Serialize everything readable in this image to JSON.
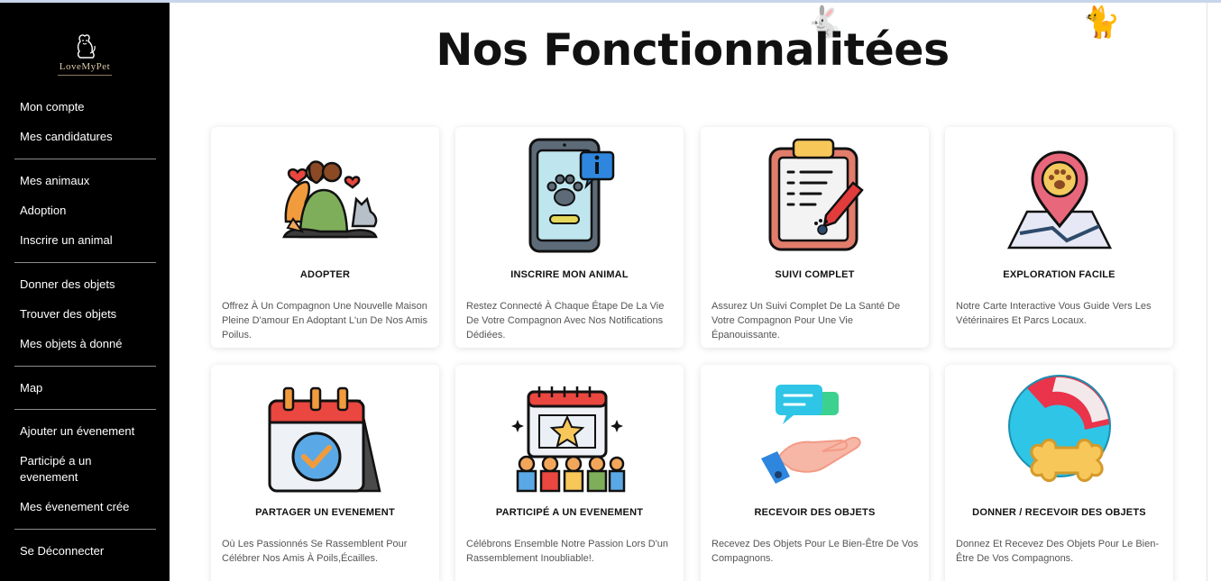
{
  "sidebar": {
    "logo_text": "LoveMyPet",
    "items": [
      {
        "label": "Mon compte"
      },
      {
        "label": "Mes candidatures"
      },
      {
        "label": "Mes animaux"
      },
      {
        "label": "Adoption"
      },
      {
        "label": "Inscrire un animal"
      },
      {
        "label": "Donner des objets"
      },
      {
        "label": "Trouver des objets"
      },
      {
        "label": "Mes objets à donné"
      },
      {
        "label": "Map"
      },
      {
        "label": "Ajouter un évenement"
      },
      {
        "label": "Participé a un evenement"
      },
      {
        "label": "Mes évenement crée"
      },
      {
        "label": "Se Déconnecter"
      }
    ]
  },
  "main": {
    "title": "Nos Fonctionnalitées",
    "cards": [
      {
        "icon": "adopt-couple-pets-icon",
        "title": "ADOPTER",
        "description": "Offrez À Un Compagnon Une Nouvelle Maison Pleine D'amour En Adoptant L'un De Nos Amis Poilus."
      },
      {
        "icon": "phone-paw-notification-icon",
        "title": "INSCRIRE MON ANIMAL",
        "description": "Restez Connecté À Chaque Étape De La Vie De Votre Compagnon Avec Nos Notifications Dédiées."
      },
      {
        "icon": "clipboard-health-icon",
        "title": "SUIVI COMPLET",
        "description": "Assurez Un Suivi Complet De La Santé De Votre Compagnon Pour Une Vie Épanouissante."
      },
      {
        "icon": "map-pin-paw-icon",
        "title": "EXPLORATION FACILE",
        "description": "Notre Carte Interactive Vous Guide Vers Les Vétérinaires Et Parcs Locaux."
      },
      {
        "icon": "calendar-check-icon",
        "title": "PARTAGER UN EVENEMENT",
        "description": "Où Les Passionnés Se Rassemblent Pour Célébrer Nos Amis À Poils,Écailles."
      },
      {
        "icon": "event-crowd-star-icon",
        "title": "PARTICIPÉ A UN EVENEMENT",
        "description": "Célébrons Ensemble Notre Passion Lors D'un Rassemblement Inoubliable!."
      },
      {
        "icon": "hand-receive-chat-icon",
        "title": "RECEVOIR DES OBJETS",
        "description": "Recevez Des Objets Pour Le Bien-Être De Vos Compagnons."
      },
      {
        "icon": "ball-bone-icon",
        "title": "DONNER / RECEVOIR DES OBJETS",
        "description": "Donnez Et Recevez Des Objets Pour Le Bien-Être De Vos Compagnons."
      }
    ]
  }
}
